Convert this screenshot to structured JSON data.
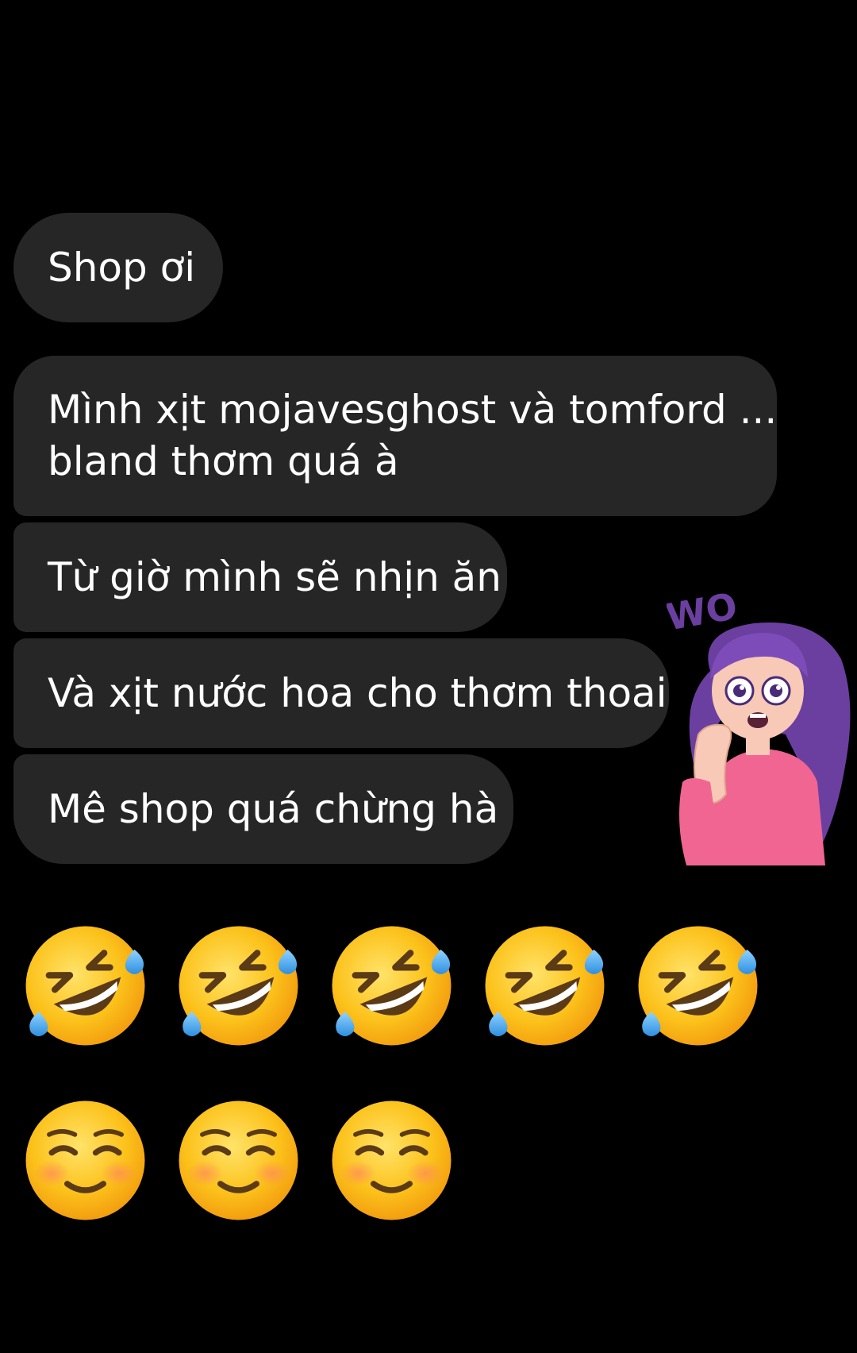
{
  "messages": [
    {
      "lines": [
        "Shop ơi"
      ]
    },
    {
      "lines": [
        "Mình xịt mojavesghost và tomford ...",
        "bland thơm quá à"
      ]
    },
    {
      "lines": [
        "Từ giờ mình sẽ nhịn ăn"
      ]
    },
    {
      "lines": [
        "Và xịt nước hoa cho thơm thoai"
      ]
    },
    {
      "lines": [
        "Mê shop quá chừng hà"
      ]
    }
  ],
  "emoji_rows": [
    [
      "rolling-on-floor-laughing",
      "rolling-on-floor-laughing",
      "rolling-on-floor-laughing",
      "rolling-on-floor-laughing",
      "rolling-on-floor-laughing"
    ],
    [
      "smiling-face",
      "smiling-face",
      "smiling-face"
    ]
  ],
  "sticker": {
    "icon": "surprised-girl-sticker",
    "text": "WO"
  },
  "colors": {
    "background": "#000000",
    "bubble": "#262626",
    "text": "#ffffff",
    "sticker_purple": "#6b3fa0",
    "sticker_pink": "#f06592"
  }
}
